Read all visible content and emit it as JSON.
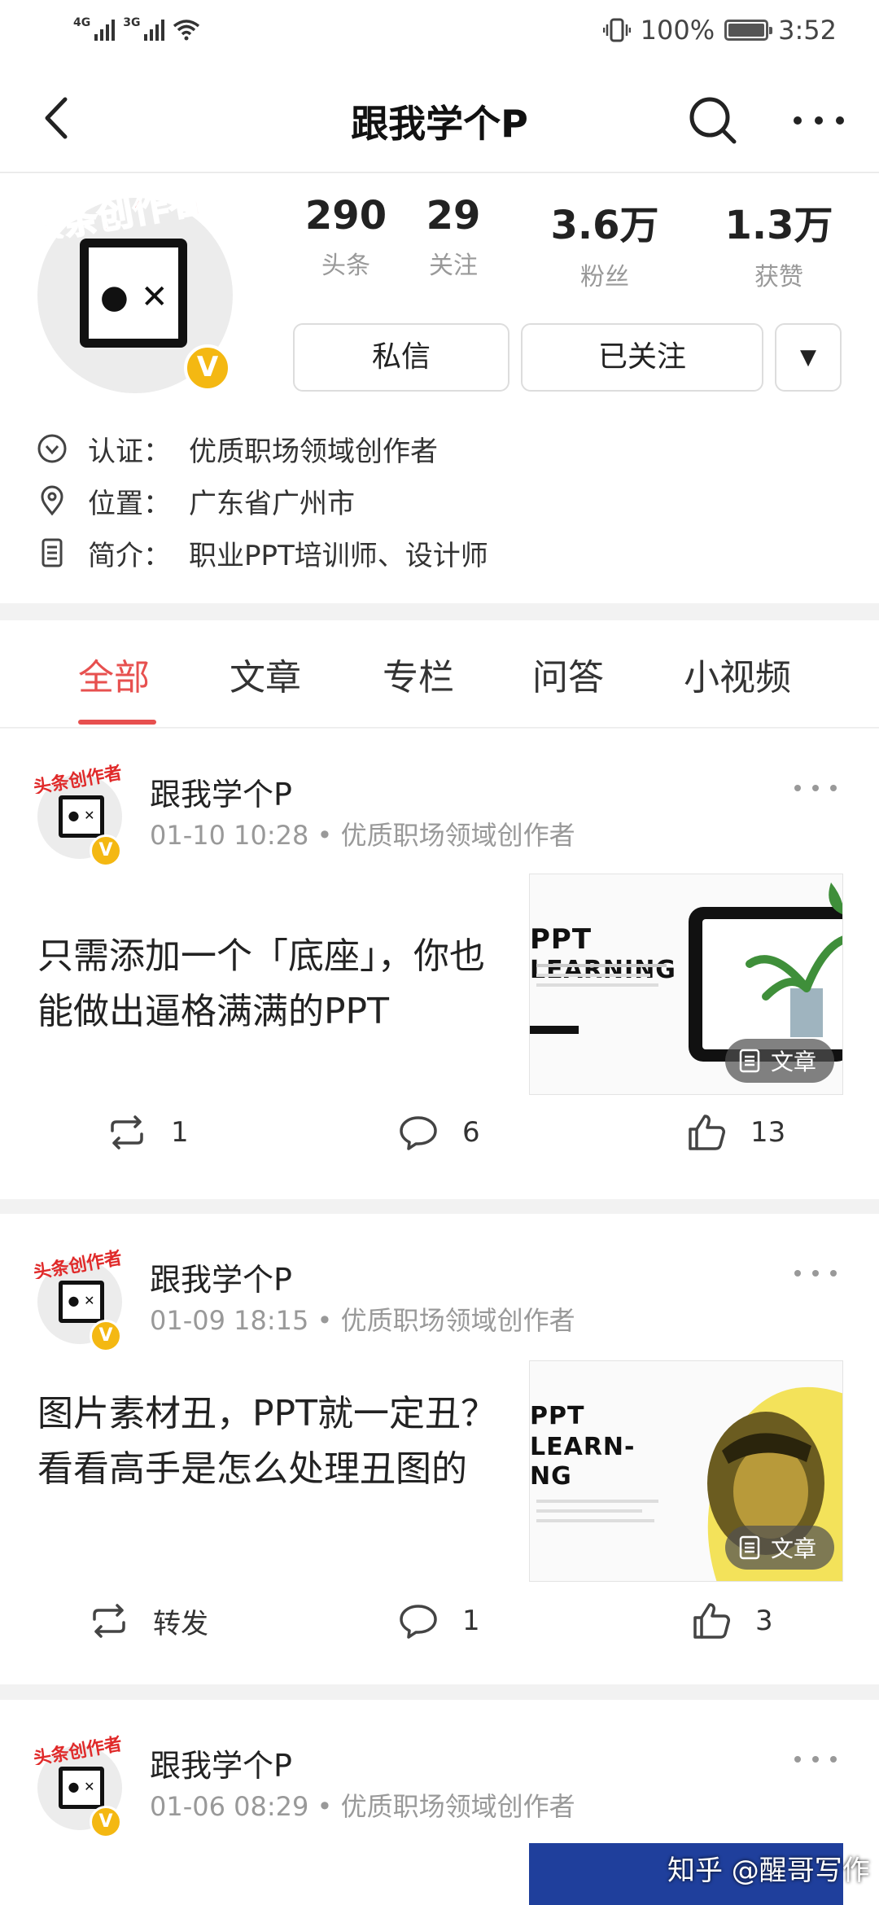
{
  "status_bar": {
    "sig1": "4G",
    "sig2": "3G",
    "battery": "100%",
    "time": "3:52"
  },
  "nav": {
    "title": "跟我学个P",
    "icons": [
      "back-icon",
      "search-icon",
      "more-icon"
    ]
  },
  "profile": {
    "badge_text": "头条创作者",
    "verified_mark": "V",
    "stats": [
      {
        "num": "290",
        "label": "头条"
      },
      {
        "num": "29",
        "label": "关注"
      },
      {
        "num": "3.6万",
        "label": "粉丝"
      },
      {
        "num": "1.3万",
        "label": "获赞"
      }
    ],
    "buttons": {
      "message": "私信",
      "following": "已关注",
      "dropdown": "▼"
    },
    "info": [
      {
        "key": "认证：",
        "value": "优质职场领域创作者",
        "icon": "verified-check-icon"
      },
      {
        "key": "位置：",
        "value": "广东省广州市",
        "icon": "location-pin-icon"
      },
      {
        "key": "简介：",
        "value": "职业PPT培训师、设计师",
        "icon": "document-icon"
      }
    ]
  },
  "tabs": [
    "全部",
    "文章",
    "专栏",
    "问答",
    "小视频"
  ],
  "accent_color": "#e7504f",
  "feed": [
    {
      "author": "跟我学个P",
      "meta": "01-10 10:28 • 优质职场领域创作者",
      "title": "只需添加一个「底座」，你也能做出逼格满满的PPT",
      "thumb_text1": "PPT",
      "thumb_text2": "LEARNING",
      "tag": "文章",
      "actions": {
        "repost": "1",
        "comment": "6",
        "like": "13"
      }
    },
    {
      "author": "跟我学个P",
      "meta": "01-09 18:15 • 优质职场领域创作者",
      "title": "图片素材丑，PPT就一定丑？看看高手是怎么处理丑图的",
      "thumb_text1": "PPT",
      "thumb_text2": "LEARN-",
      "thumb_text3": "NG",
      "tag": "文章",
      "actions": {
        "repost": "转发",
        "comment": "1",
        "like": "3"
      }
    },
    {
      "author": "跟我学个P",
      "meta": "01-06 08:29 • 优质职场领域创作者"
    }
  ],
  "watermark": "知乎 @醒哥写作"
}
